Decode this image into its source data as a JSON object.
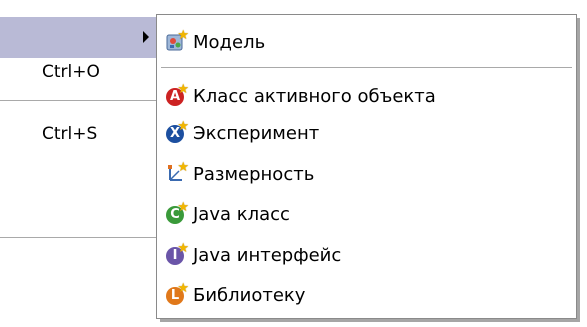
{
  "parent_menu": {
    "items": [
      {
        "shortcut": ""
      },
      {
        "shortcut": "Ctrl+O"
      },
      {
        "shortcut": "Ctrl+S"
      }
    ]
  },
  "submenu": {
    "items": [
      {
        "label": "Модель",
        "icon": "model-icon"
      },
      {
        "label": "Класс активного объекта",
        "icon": "active-object-class-icon",
        "color": "#cc2222",
        "glyph": "A"
      },
      {
        "label": "Эксперимент",
        "icon": "experiment-icon",
        "color": "#1c4fa0",
        "glyph": "X"
      },
      {
        "label": "Размерность",
        "icon": "dimension-icon"
      },
      {
        "label": "Java класс",
        "icon": "java-class-icon",
        "color": "#3a9a3a",
        "glyph": "C"
      },
      {
        "label": "Java интерфейс",
        "icon": "java-interface-icon",
        "color": "#6a55a8",
        "glyph": "I"
      },
      {
        "label": "Библиотеку",
        "icon": "library-icon",
        "color": "#e0781a",
        "glyph": "L"
      }
    ]
  }
}
